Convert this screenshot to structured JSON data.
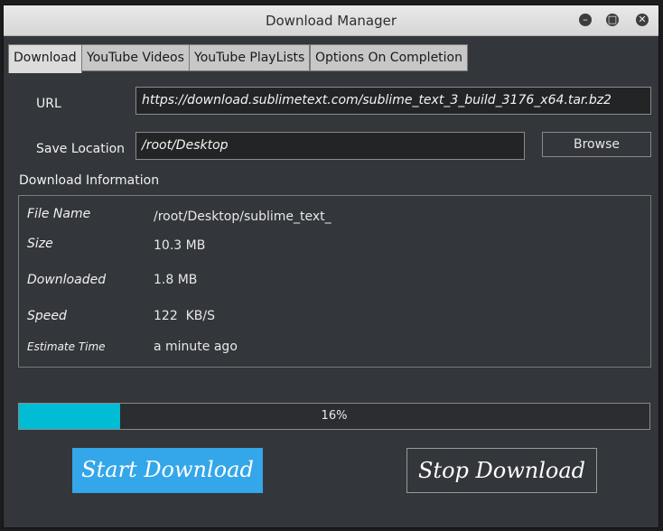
{
  "window": {
    "title": "Download Manager",
    "controls": [
      "minimize",
      "maximize",
      "close"
    ]
  },
  "tabs": [
    {
      "label": "Download",
      "active": true
    },
    {
      "label": "YouTube Videos",
      "active": false
    },
    {
      "label": "YouTube PlayLists",
      "active": false
    },
    {
      "label": "Options On Completion",
      "active": false
    }
  ],
  "form": {
    "url_label": "URL",
    "url_value": "https://download.sublimetext.com/sublime_text_3_build_3176_x64.tar.bz2",
    "save_label": "Save Location",
    "save_value": "/root/Desktop",
    "browse_label": "Browse"
  },
  "info": {
    "group_label": "Download Information",
    "rows": [
      {
        "key": "File Name",
        "value": "/root/Desktop/sublime_text_"
      },
      {
        "key": "Size",
        "value": "10.3 MB"
      },
      {
        "key": "Downloaded",
        "value": "1.8 MB"
      },
      {
        "key": "Speed",
        "value": "122  KB/S"
      },
      {
        "key": "Estimate Time",
        "value": "a minute ago"
      }
    ]
  },
  "progress": {
    "percent": 16,
    "text": "16%",
    "color": "#00bcd4"
  },
  "actions": {
    "start_label": "Start Download",
    "stop_label": "Stop Download"
  }
}
